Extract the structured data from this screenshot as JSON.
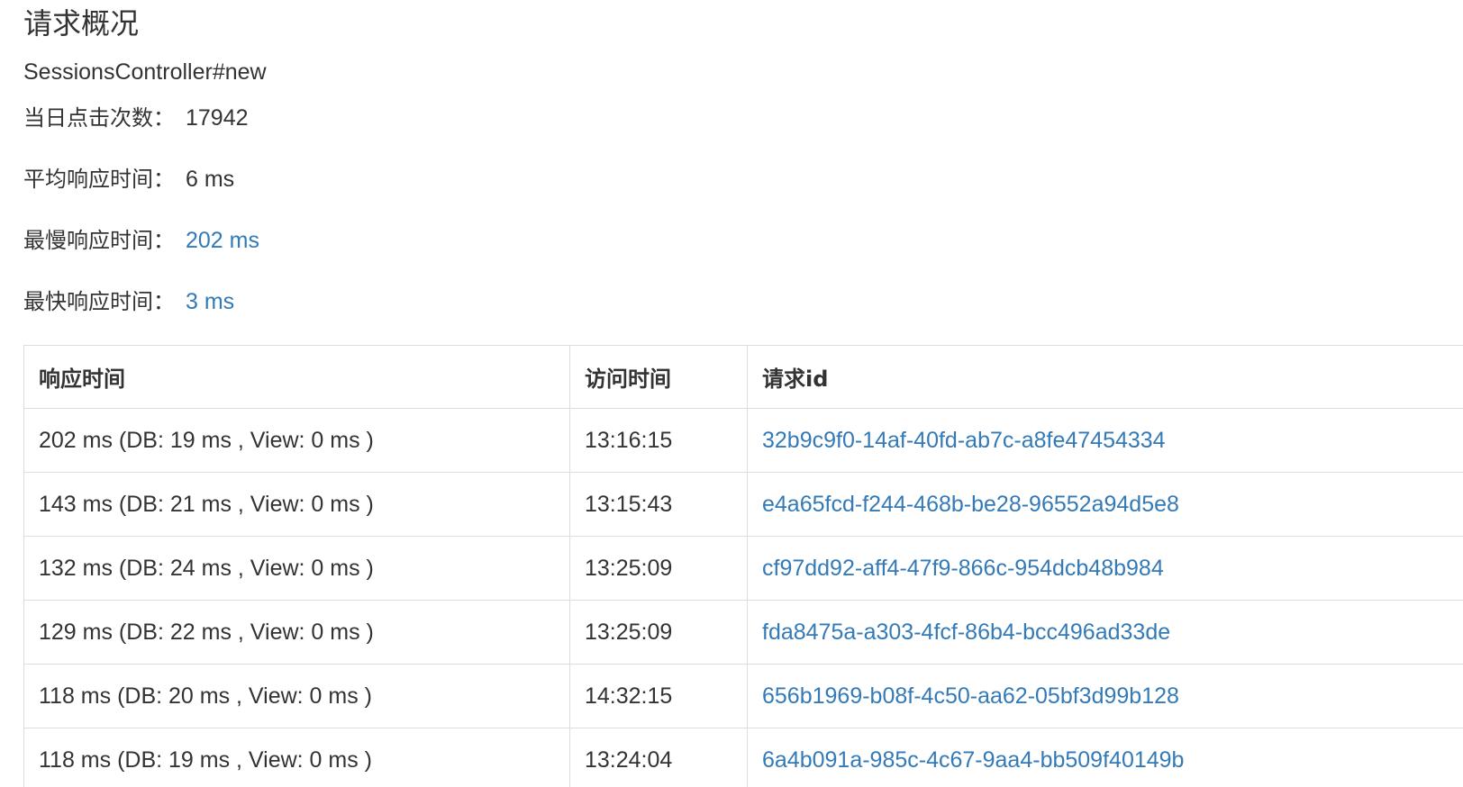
{
  "header": {
    "title": "请求概况",
    "action": "SessionsController#new"
  },
  "stats": {
    "daily_clicks": {
      "label": "当日点击次数：",
      "value": "17942"
    },
    "avg_response": {
      "label": "平均响应时间：",
      "value": "6 ms"
    },
    "slowest_response": {
      "label": "最慢响应时间：",
      "value": "202 ms"
    },
    "fastest_response": {
      "label": "最快响应时间：",
      "value": "3 ms"
    }
  },
  "table": {
    "columns": [
      "响应时间",
      "访问时间",
      "请求id"
    ],
    "rows": [
      {
        "response": "202 ms (DB: 19 ms , View: 0 ms )",
        "time": "13:16:15",
        "request_id": "32b9c9f0-14af-40fd-ab7c-a8fe47454334"
      },
      {
        "response": "143 ms (DB: 21 ms , View: 0 ms )",
        "time": "13:15:43",
        "request_id": "e4a65fcd-f244-468b-be28-96552a94d5e8"
      },
      {
        "response": "132 ms (DB: 24 ms , View: 0 ms )",
        "time": "13:25:09",
        "request_id": "cf97dd92-aff4-47f9-866c-954dcb48b984"
      },
      {
        "response": "129 ms (DB: 22 ms , View: 0 ms )",
        "time": "13:25:09",
        "request_id": "fda8475a-a303-4fcf-86b4-bcc496ad33de"
      },
      {
        "response": "118 ms (DB: 20 ms , View: 0 ms )",
        "time": "14:32:15",
        "request_id": "656b1969-b08f-4c50-aa62-05bf3d99b128"
      },
      {
        "response": "118 ms (DB: 19 ms , View: 0 ms )",
        "time": "13:24:04",
        "request_id": "6a4b091a-985c-4c67-9aa4-bb509f40149b"
      }
    ]
  },
  "colors": {
    "link": "#337ab7",
    "text": "#333333",
    "border": "#dddddd"
  }
}
